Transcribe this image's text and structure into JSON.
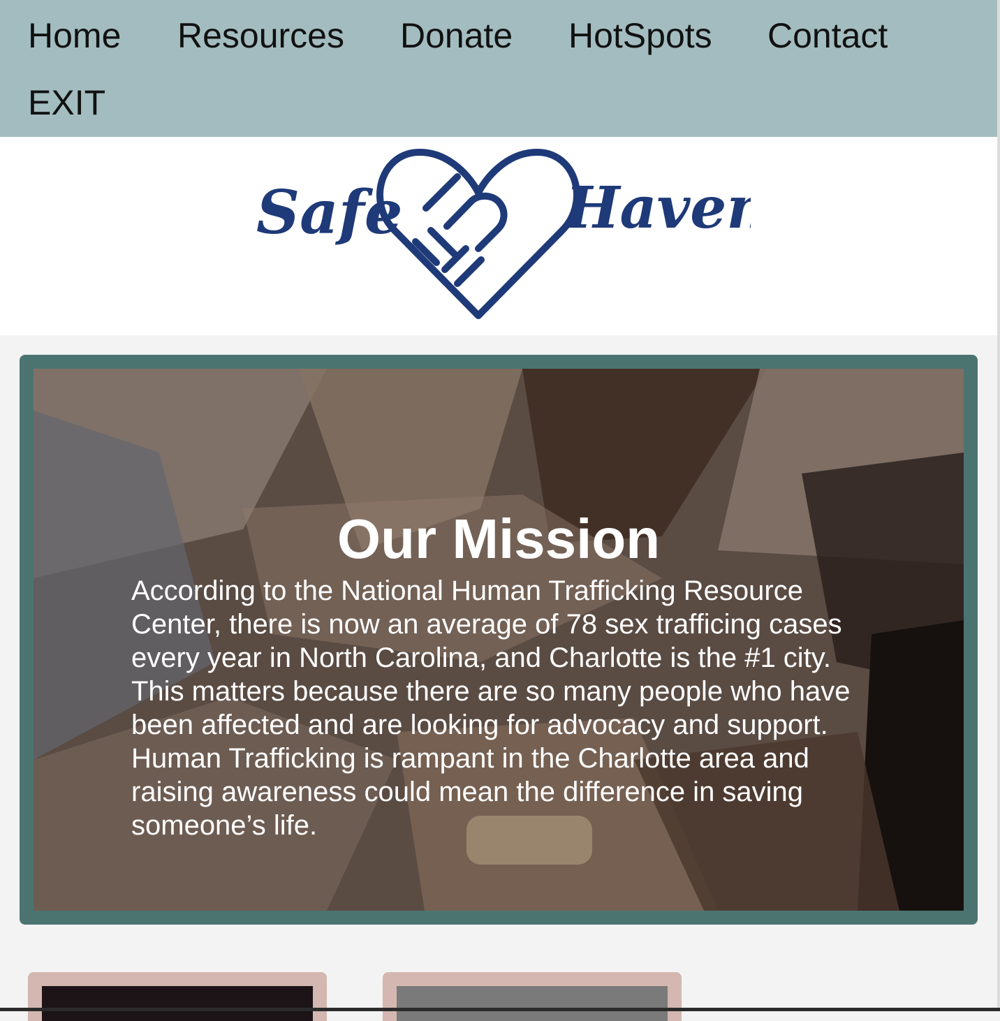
{
  "nav": {
    "items": [
      {
        "label": "Home"
      },
      {
        "label": "Resources"
      },
      {
        "label": "Donate"
      },
      {
        "label": "HotSpots"
      },
      {
        "label": "Contact"
      },
      {
        "label": "EXIT"
      }
    ]
  },
  "logo": {
    "text_left": "Safe",
    "text_right": "Haven",
    "icon": "heart-handshake-icon",
    "color": "#1f3a78"
  },
  "mission": {
    "title": "Our Mission",
    "body": "According to the National Human Trafficking Resource Center, there is now an average of 78 sex trafficing cases every year in North Carolina, and Charlotte is the #1 city. This matters because there are so many people who have been affected and are looking for advocacy and support. Human Trafficking is rampant in the Charlotte area and raising awareness could mean the difference in saving someone’s life."
  },
  "colors": {
    "nav_bg": "#a3bcbf",
    "card_border": "#4b7471",
    "bottom_card": "#d3b7b0"
  }
}
